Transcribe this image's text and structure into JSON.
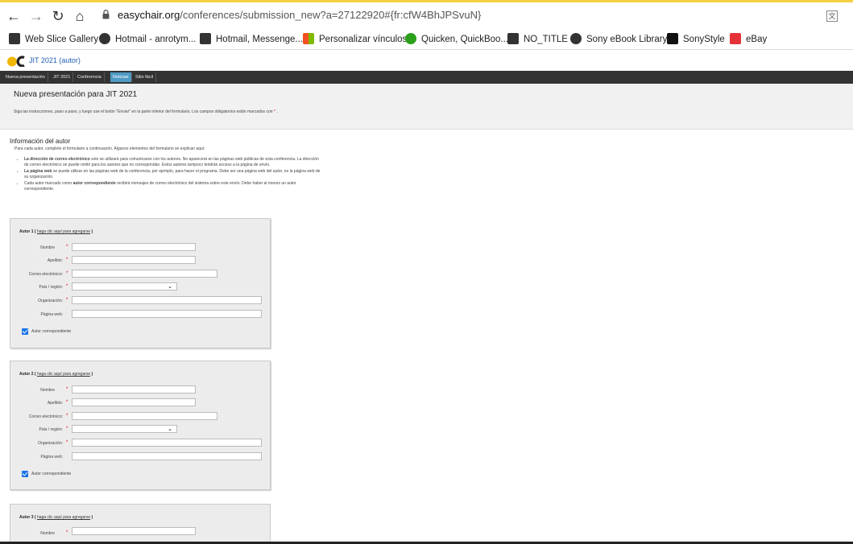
{
  "browser": {
    "url_host": "easychair.org",
    "url_path": "/conferences/submission_new?a=27122920#{fr:cfW4BhJPSvuN}"
  },
  "bookmarks": [
    {
      "label": "Web Slice Gallery",
      "color": "#333333"
    },
    {
      "label": "Hotmail - anrotym...",
      "color": "#333333"
    },
    {
      "label": "Hotmail, Messenge...",
      "color": "#333333"
    },
    {
      "label": "Personalizar vínculos",
      "color": "#f25022"
    },
    {
      "label": "Quicken, QuickBoo...",
      "color": "#2ca01c"
    },
    {
      "label": "NO_TITLE",
      "color": "#333333"
    },
    {
      "label": "Sony eBook Library",
      "color": "#333333"
    },
    {
      "label": "SonyStyle",
      "color": "#111111"
    },
    {
      "label": "eBay",
      "color": "#e53238"
    }
  ],
  "site": {
    "title": "JIT 2021 (autor)",
    "menu": [
      "Nueva presentación",
      "JIT 2021",
      "Conferencia",
      "Noticias",
      "Sitio fácil"
    ],
    "active_menu": "Noticias"
  },
  "page": {
    "title": "Nueva presentación para JIT 2021",
    "intro": "Siga las instrucciones, paso a paso, y luego use el botón \"Enviar\" en la parte inferior del formulario. Los campos obligatorios están marcados con",
    "intro_star": "*",
    "section_title": "Información del autor",
    "section_sub": "Para cada autor, complete el formulario a continuación. Algunos elementos del formulario se explican aquí:",
    "bullets": [
      {
        "bold": "La dirección de correo electrónico",
        "text": " solo se utilizará para comunicarse con los autores. No aparecerá en las páginas web públicas de esta conferencia. La dirección de correo electrónico se puede omitir para los autores que no correspondan. Estos autores tampoco tendrán acceso a la página de envío."
      },
      {
        "bold": "La página web",
        "text": " se puede utilizar en las páginas web de la conferencia, por ejemplo, para hacer el programa. Debe ser una página web del autor, no la página web de su organización."
      },
      {
        "pre": "Cada autor marcado como ",
        "bold": "autor correspondiente",
        "text": " recibirá mensajes de correo electrónico del sistema sobre este envío. Debe haber al menos un autor correspondiente."
      }
    ]
  },
  "form": {
    "add_link": "haga clic aquí para agregarse",
    "fields": {
      "nombre": "Nombre",
      "apellido": "Apellido:",
      "email": "Correo electrónico:",
      "pais": "País / región:",
      "org": "Organización:",
      "web": "Página web:"
    },
    "required_star": "*",
    "corresponding_label": "Autor correspondiente",
    "authors": [
      {
        "title": "Autor 1",
        "corresponding": true
      },
      {
        "title": "Autor 2",
        "corresponding": true
      },
      {
        "title": "Autor 3",
        "corresponding": false
      }
    ]
  }
}
